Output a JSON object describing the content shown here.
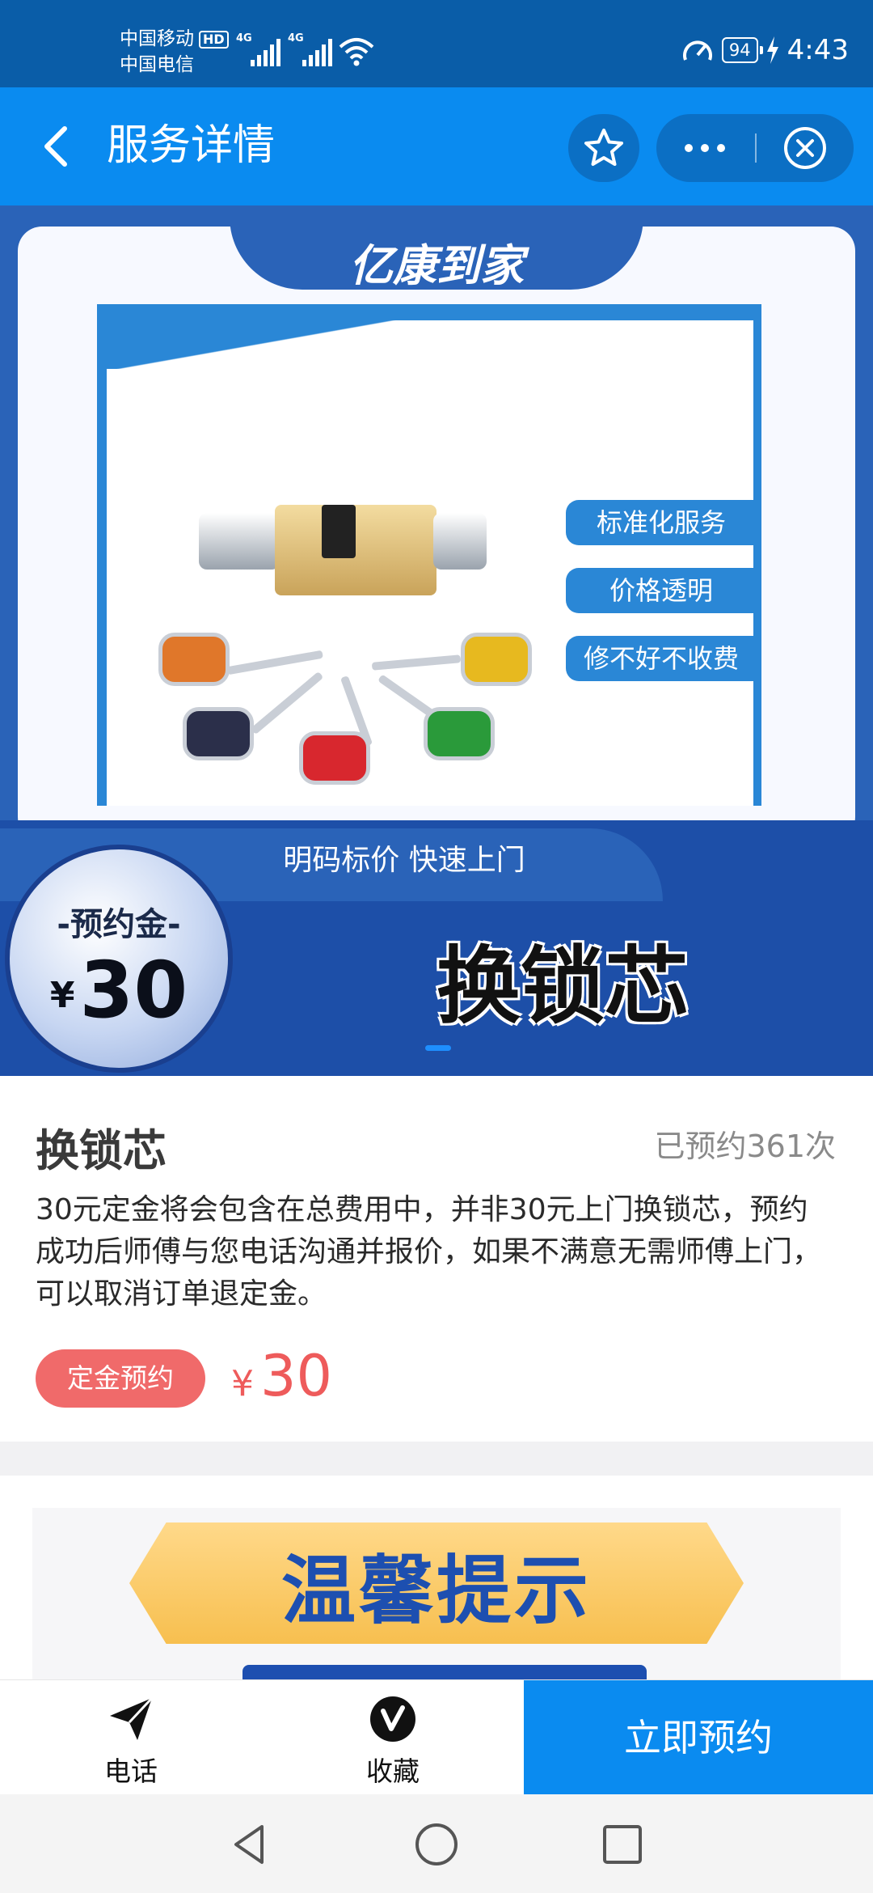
{
  "status_bar": {
    "carrier1": "中国移动",
    "hd": "HD",
    "carrier2": "中国电信",
    "net1": "4G",
    "net2": "4G",
    "battery": "94",
    "time": "4:43"
  },
  "nav": {
    "title": "服务详情"
  },
  "banner": {
    "brand": "亿康到家",
    "tags": [
      "标准化服务",
      "价格透明",
      "修不好不收费"
    ],
    "slogan": "明码标价 快速上门",
    "deposit_label": "-预约金-",
    "deposit_currency": "¥",
    "deposit_amount": "30",
    "service_name": "换锁芯"
  },
  "product": {
    "title": "换锁芯",
    "booked_count": "已预约361次",
    "description": "30元定金将会包含在总费用中，并非30元上门换锁芯，预约成功后师傅与您电话沟通并报价，如果不满意无需师傅上门，可以取消订单退定金。",
    "badge": "定金预约",
    "currency": "¥",
    "price": "30"
  },
  "tip": {
    "title": "温馨提示"
  },
  "actions": {
    "phone_label": "电话",
    "favorite_label": "收藏",
    "book_label": "立即预约"
  },
  "colors": {
    "primary": "#0a8bf0",
    "status_bar": "#0a5da8",
    "price": "#ee5b5b",
    "badge": "#f06a6a"
  },
  "icons": [
    "back-arrow-icon",
    "star-icon",
    "more-icon",
    "close-icon",
    "send-icon",
    "v-icon",
    "triangle-back-icon",
    "circle-home-icon",
    "square-recents-icon"
  ]
}
